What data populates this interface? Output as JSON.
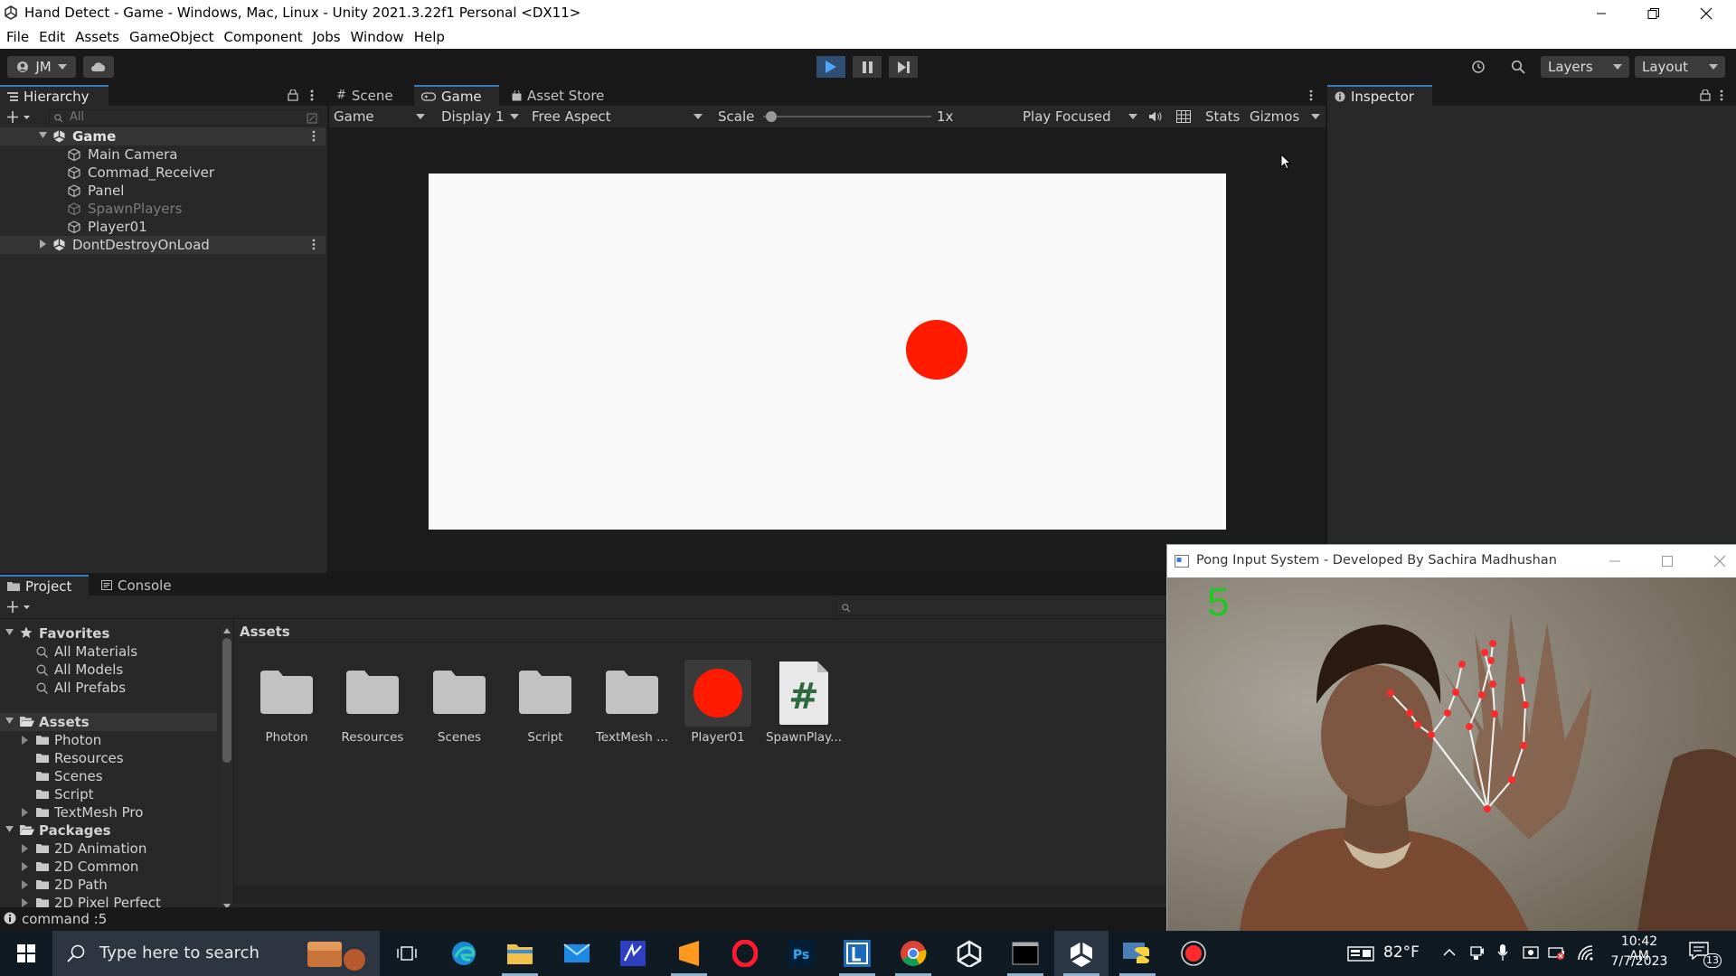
{
  "window": {
    "title": "Hand Detect - Game - Windows, Mac, Linux - Unity 2021.3.22f1 Personal <DX11>"
  },
  "menu": [
    "File",
    "Edit",
    "Assets",
    "GameObject",
    "Component",
    "Jobs",
    "Window",
    "Help"
  ],
  "toolbar": {
    "account": "JM",
    "layers": "Layers",
    "layout": "Layout"
  },
  "hierarchy": {
    "tab": "Hierarchy",
    "search_placeholder": "All",
    "items": [
      {
        "label": "Game",
        "kind": "scene"
      },
      {
        "label": "Main Camera",
        "kind": "object"
      },
      {
        "label": "Commad_Receiver",
        "kind": "object"
      },
      {
        "label": "Panel",
        "kind": "object"
      },
      {
        "label": "SpawnPlayers",
        "kind": "object-disabled"
      },
      {
        "label": "Player01",
        "kind": "object"
      },
      {
        "label": "DontDestroyOnLoad",
        "kind": "scene"
      }
    ]
  },
  "center_tabs": [
    "Scene",
    "Game",
    "Asset Store"
  ],
  "game_toolbar": {
    "view": "Game",
    "display": "Display 1",
    "aspect": "Free Aspect",
    "scale_label": "Scale",
    "scale_value": "1x",
    "play_focused": "Play Focused",
    "stats": "Stats",
    "gizmos": "Gizmos"
  },
  "game_view": {
    "background": "#f9f9f9",
    "ball_color": "#ff1a00"
  },
  "inspector": {
    "tab": "Inspector"
  },
  "bottom_tabs": [
    "Project",
    "Console"
  ],
  "project_tree": {
    "favorites_label": "Favorites",
    "favorites": [
      "All Materials",
      "All Models",
      "All Prefabs"
    ],
    "assets_label": "Assets",
    "assets": [
      "Photon",
      "Resources",
      "Scenes",
      "Script",
      "TextMesh Pro"
    ],
    "packages_label": "Packages",
    "packages": [
      "2D Animation",
      "2D Common",
      "2D Path",
      "2D Pixel Perfect"
    ]
  },
  "assets_panel": {
    "breadcrumb": "Assets",
    "items": [
      {
        "label": "Photon",
        "icon": "folder-icon"
      },
      {
        "label": "Resources",
        "icon": "folder-icon"
      },
      {
        "label": "Scenes",
        "icon": "folder-icon"
      },
      {
        "label": "Script",
        "icon": "folder-icon"
      },
      {
        "label": "TextMesh ...",
        "icon": "folder-icon"
      },
      {
        "label": "Player01",
        "icon": "prefab-red-circle-icon"
      },
      {
        "label": "SpawnPlay...",
        "icon": "csharp-script-icon"
      }
    ]
  },
  "status_bar": {
    "message": "command :5"
  },
  "webcam_window": {
    "title": "Pong Input System - Developed By Sachira Madhushan",
    "finger_count": "5",
    "count_color": "#1ec81e",
    "landmark_color": "#ff2a2a"
  },
  "taskbar": {
    "search_placeholder": "Type here to search",
    "weather": "82°F",
    "time": "10:42 AM",
    "date": "7/7/2023",
    "notifications": "13"
  }
}
